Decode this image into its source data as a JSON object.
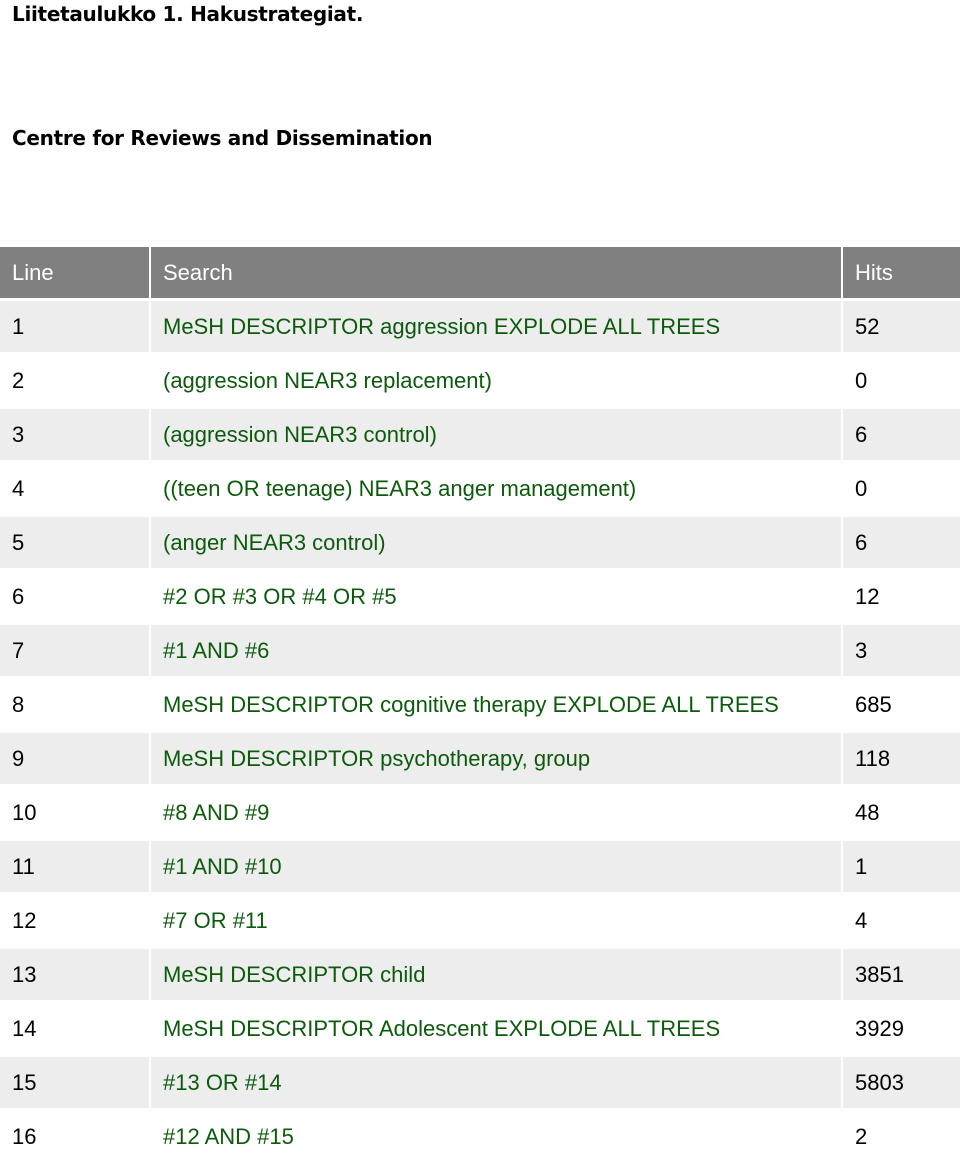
{
  "document": {
    "title": "Liitetaulukko 1. Hakustrategiat.",
    "section_title": "Centre for Reviews and Dissemination"
  },
  "table": {
    "headers": {
      "line": "Line",
      "search": "Search",
      "hits": "Hits"
    },
    "rows": [
      {
        "line": "1",
        "search": "MeSH DESCRIPTOR aggression EXPLODE ALL TREES",
        "hits": "52"
      },
      {
        "line": "2",
        "search": "(aggression NEAR3 replacement)",
        "hits": "0"
      },
      {
        "line": "3",
        "search": "(aggression NEAR3 control)",
        "hits": "6"
      },
      {
        "line": "4",
        "search": "((teen OR teenage) NEAR3 anger management)",
        "hits": "0"
      },
      {
        "line": "5",
        "search": "(anger NEAR3 control)",
        "hits": "6"
      },
      {
        "line": "6",
        "search": "#2 OR #3 OR #4 OR #5",
        "hits": "12"
      },
      {
        "line": "7",
        "search": "#1 AND #6",
        "hits": "3"
      },
      {
        "line": "8",
        "search": "MeSH DESCRIPTOR cognitive therapy EXPLODE ALL TREES",
        "hits": "685"
      },
      {
        "line": "9",
        "search": "MeSH DESCRIPTOR psychotherapy, group",
        "hits": "118"
      },
      {
        "line": "10",
        "search": "#8 AND #9",
        "hits": "48"
      },
      {
        "line": "11",
        "search": "#1 AND #10",
        "hits": "1"
      },
      {
        "line": "12",
        "search": "#7 OR #11",
        "hits": "4"
      },
      {
        "line": "13",
        "search": "MeSH DESCRIPTOR child",
        "hits": "3851"
      },
      {
        "line": "14",
        "search": "MeSH DESCRIPTOR Adolescent EXPLODE ALL TREES",
        "hits": "3929"
      },
      {
        "line": "15",
        "search": "#13 OR #14",
        "hits": "5803"
      },
      {
        "line": "16",
        "search": "#12 AND #15",
        "hits": "2"
      }
    ]
  },
  "colors": {
    "header_background": "#808080",
    "header_text": "#ffffff",
    "row_shaded": "#ededed",
    "row_plain": "#ffffff",
    "search_text": "#0c5a0c",
    "body_text": "#000000"
  }
}
